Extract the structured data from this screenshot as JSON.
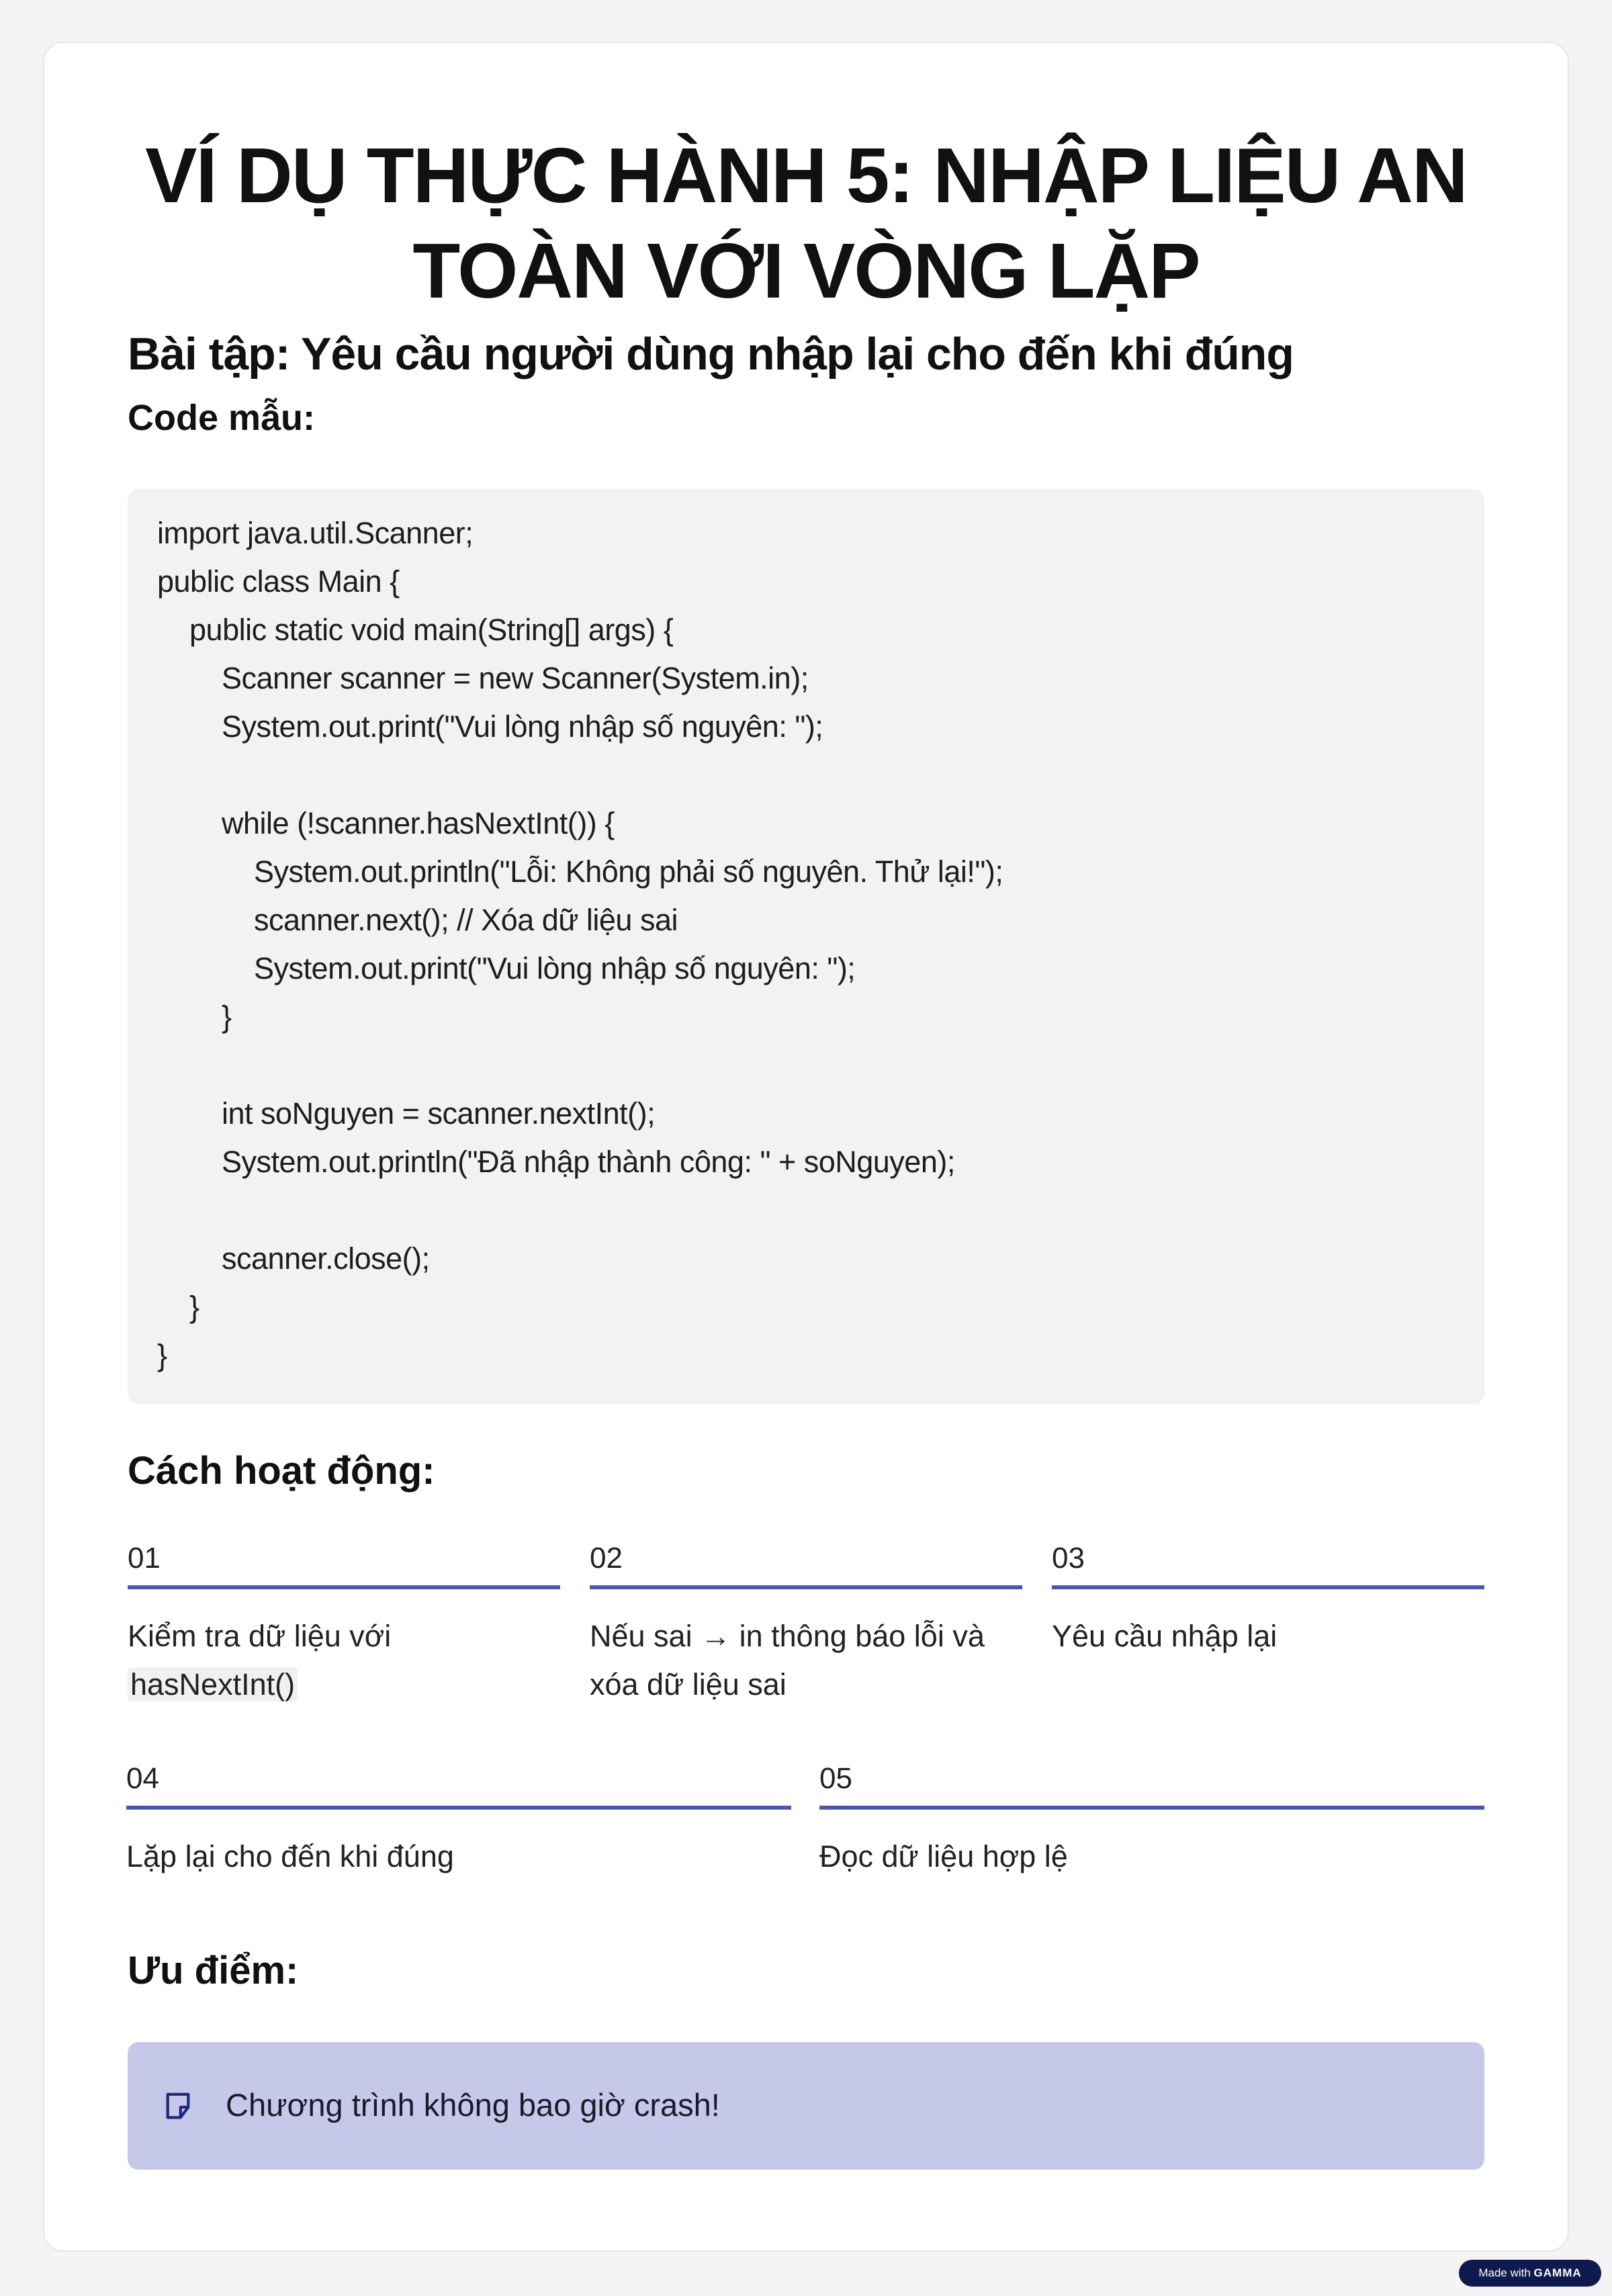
{
  "title": "VÍ DỤ THỰC HÀNH 5: NHẬP LIỆU AN TOÀN VỚI VÒNG LẶP",
  "subtitle": "Bài tập: Yêu cầu người dùng nhập lại cho đến khi đúng",
  "code_heading": "Code mẫu:",
  "code_lines": [
    "import java.util.Scanner;",
    "public class Main {",
    "    public static void main(String[] args) {",
    "        Scanner scanner = new Scanner(System.in);",
    "        System.out.print(\"Vui lòng nhập số nguyên: \");",
    "",
    "        while (!scanner.hasNextInt()) {",
    "            System.out.println(\"Lỗi: Không phải số nguyên. Thử lại!\");",
    "            scanner.next(); // Xóa dữ liệu sai",
    "            System.out.print(\"Vui lòng nhập số nguyên: \");",
    "        }",
    "",
    "        int soNguyen = scanner.nextInt();",
    "        System.out.println(\"Đã nhập thành công: \" + soNguyen);",
    "",
    "        scanner.close();",
    "    }",
    "}"
  ],
  "how_heading": "Cách hoạt động:",
  "steps": [
    {
      "num": "01",
      "text": "Kiểm tra dữ liệu với",
      "code": "hasNextInt()"
    },
    {
      "num": "02",
      "text": "Nếu sai → in thông báo lỗi và xóa dữ liệu sai"
    },
    {
      "num": "03",
      "text": "Yêu cầu nhập lại"
    },
    {
      "num": "04",
      "text": "Lặp lại cho đến khi đúng"
    },
    {
      "num": "05",
      "text": "Đọc dữ liệu hợp lệ"
    }
  ],
  "adv_heading": "Ưu điểm:",
  "callout": {
    "icon": "note-icon",
    "text": "Chương trình không bao giờ crash!"
  },
  "badge": {
    "prefix": "Made with",
    "brand": "GAMMA"
  },
  "colors": {
    "accent_rule": "#4b55b4",
    "callout_bg": "#c5c8e8",
    "code_bg": "#f2f2f2",
    "badge_bg": "#0f1b4f"
  }
}
